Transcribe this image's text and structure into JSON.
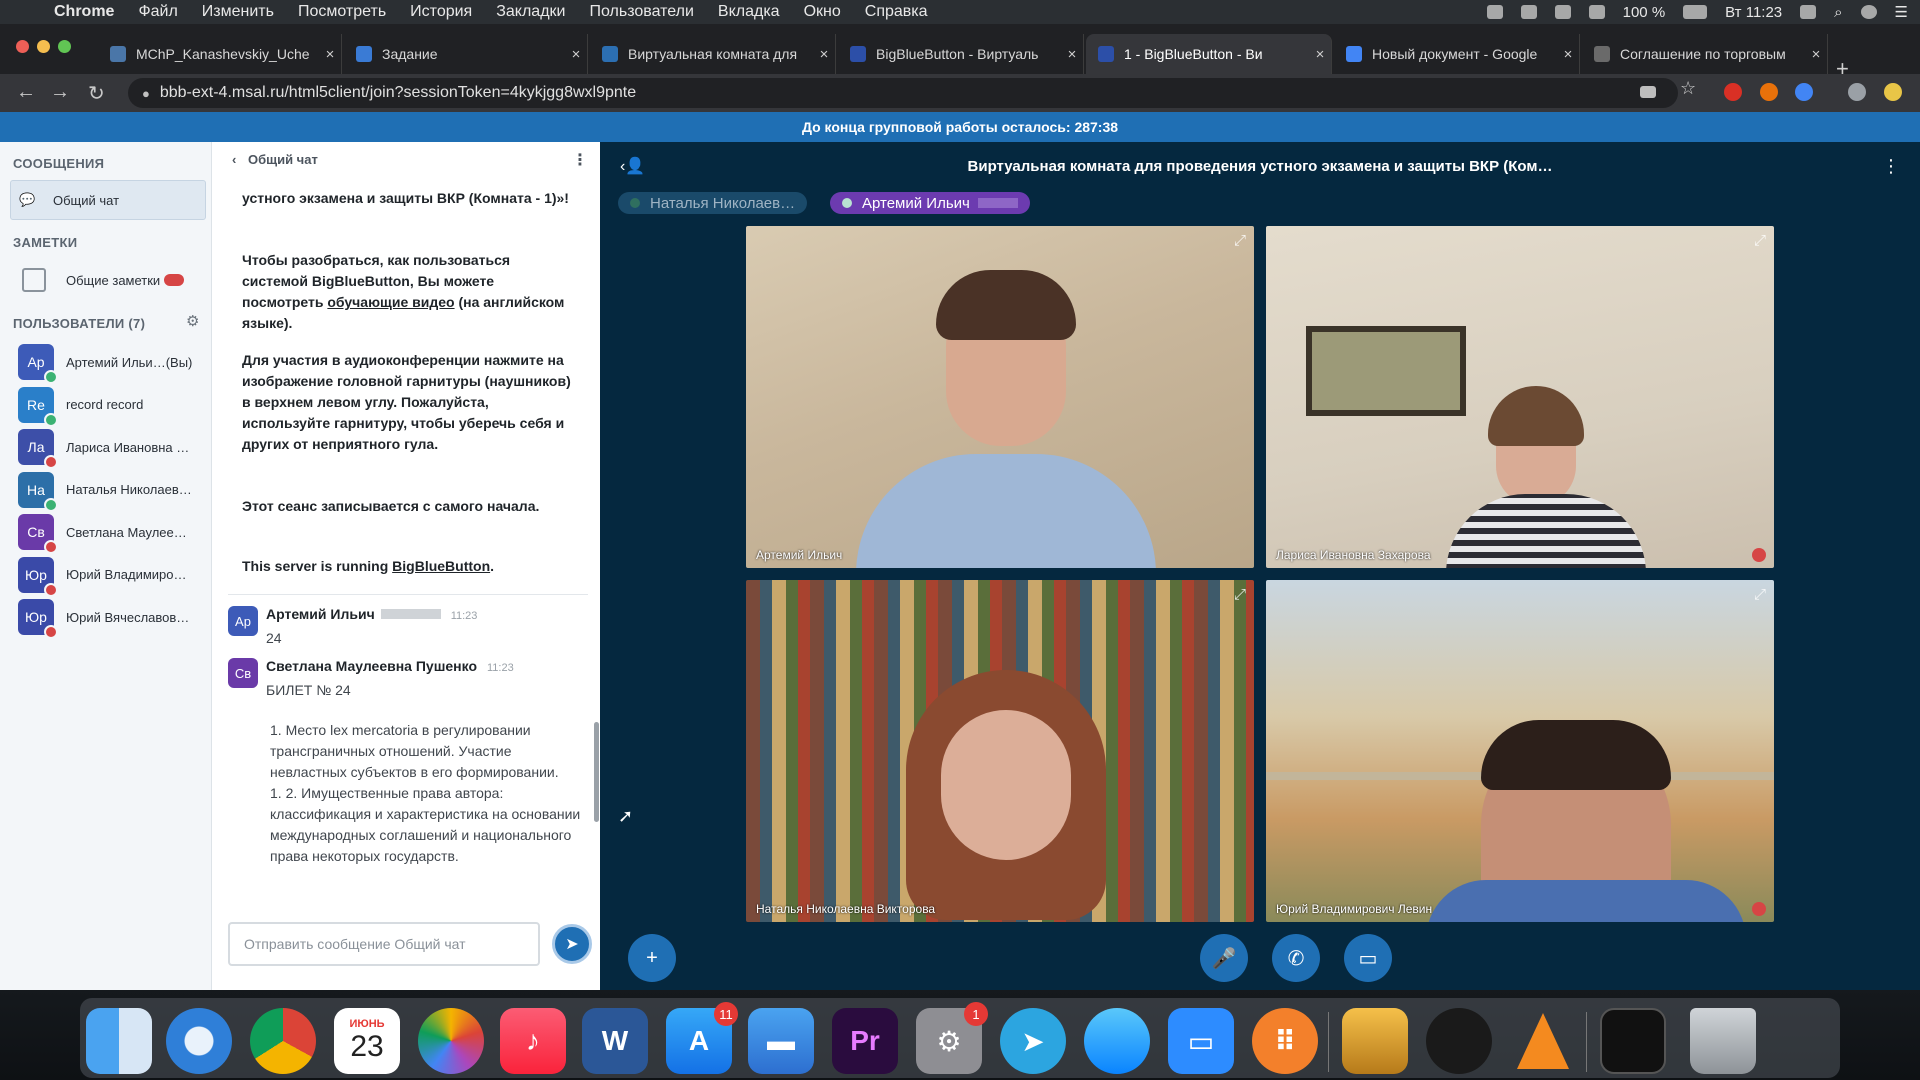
{
  "menubar": {
    "app": "Chrome",
    "items": [
      "Файл",
      "Изменить",
      "Посмотреть",
      "История",
      "Закладки",
      "Пользователи",
      "Вкладка",
      "Окно",
      "Справка"
    ],
    "battery": "100 %",
    "clock": "Вт 11:23"
  },
  "tabs": [
    {
      "label": "MChP_Kanashevskiy_Uche",
      "close": "×",
      "color": "#4a76a8"
    },
    {
      "label": "Задание",
      "close": "×",
      "color": "#3a7bd5"
    },
    {
      "label": "Виртуальная комната для",
      "close": "×",
      "color": "#2c6fb2"
    },
    {
      "label": "BigBlueButton - Виртуаль",
      "close": "×",
      "color": "#2c4fa8"
    },
    {
      "label": "1 - BigBlueButton - Ви",
      "close": "×",
      "color": "#2c4fa8"
    },
    {
      "label": "Новый документ - Google",
      "close": "×",
      "color": "#4285f4"
    },
    {
      "label": "Соглашение по торговым",
      "close": "×",
      "color": "#6a6a6a"
    }
  ],
  "newtab": "+",
  "url": "bbb-ext-4.msal.ru/html5client/join?sessionToken=4kykjgg8wxl9pnte",
  "banner": "До конца групповой работы осталось: 287:38",
  "sidebar": {
    "messages_header": "СООБЩЕНИЯ",
    "public_chat": "Общий чат",
    "notes_header": "ЗАМЕТКИ",
    "shared_notes": "Общие заметки",
    "users_header": "ПОЛЬЗОВАТЕЛИ (7)",
    "users": [
      {
        "initials": "Ар",
        "name": "Артемий Ильи…(Вы)",
        "color": "#3d5bb8",
        "status": "#3bb273"
      },
      {
        "initials": "Re",
        "name": "record record",
        "color": "#2a7fc9",
        "status": "#3bb273"
      },
      {
        "initials": "Ла",
        "name": "Лариса Ивановна …",
        "color": "#3d4fa8",
        "status": "#d64545"
      },
      {
        "initials": "На",
        "name": "Наталья Николаев…",
        "color": "#2c6fa8",
        "status": "#3bb273"
      },
      {
        "initials": "Св",
        "name": "Светлана Маулее…",
        "color": "#6a3aa8",
        "status": "#d64545"
      },
      {
        "initials": "Юр",
        "name": "Юрий Владимиро…",
        "color": "#3a4aa8",
        "status": "#d64545"
      },
      {
        "initials": "Юр",
        "name": "Юрий Вячеславов…",
        "color": "#3a4aa8",
        "status": "#d64545"
      }
    ]
  },
  "chat": {
    "back_label": "Общий чат",
    "welcome_1": "устного экзамена и защиты ВКР (Комната - 1)»!",
    "welcome_2_pre": "Чтобы разобраться, как пользоваться системой BigBlueButton, Вы можете посмотреть ",
    "welcome_2_link": "обучающие видео",
    "welcome_2_post": " (на английском языке).",
    "welcome_3": "Для участия в аудиоконференции нажмите на изображение головной гарнитуры (наушников) в верхнем левом углу. Пожалуйста, используйте гарнитуру, чтобы уберечь себя и других от неприятного гула.",
    "welcome_4": "Этот сеанс записывается с самого начала.",
    "welcome_5_pre": "This server is running ",
    "welcome_5_link": "BigBlueButton",
    "welcome_5_post": ".",
    "messages": [
      {
        "initials": "Ар",
        "author": "Артемий Ильич",
        "time": "11:23",
        "text": "24",
        "color": "#3d5bb8"
      },
      {
        "initials": "Св",
        "author": "Светлана Маулеевна Пушенко",
        "time": "11:23",
        "text": "БИЛЕТ № 24",
        "color": "#6a3aa8"
      }
    ],
    "ticket_text": "1. Место lex mercatoria в регулировании трансграничных отношений. Участие невластных субъектов в его формировании.\n1. 2. Имущественные права автора: классификация и характеристика на основании международных соглашений и национального права некоторых государств.",
    "input_placeholder": "Отправить сообщение Общий чат"
  },
  "meeting": {
    "title": "Виртуальная комната для проведения устного экзамена и защиты ВКР (Ком…",
    "talkers": [
      "Наталья Николаев…",
      "Артемий Ильич"
    ],
    "videos": [
      {
        "label": "Артемий Ильич"
      },
      {
        "label": "Лариса Ивановна Захарова"
      },
      {
        "label": "Наталья Николаевна Викторова"
      },
      {
        "label": "Юрий Владимирович Левин"
      }
    ]
  },
  "dock": {
    "calendar_month": "ИЮНЬ",
    "calendar_day": "23",
    "appstore_badge": "11",
    "settings_badge": "1",
    "word_label": "W",
    "premiere_label": "Pr"
  }
}
